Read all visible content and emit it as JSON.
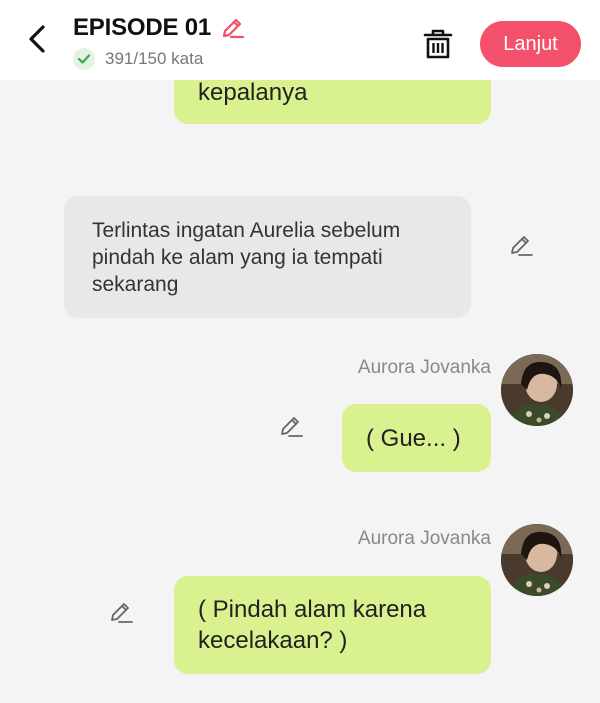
{
  "header": {
    "title": "EPISODE 01",
    "word_count": "391/150 kata",
    "next_label": "Lanjut",
    "accent_color": "#f2506b"
  },
  "messages": {
    "top_bubble_text": "kepalanya",
    "narration_text": "Terlintas ingatan Aurelia sebelum pindah ke alam yang ia tempati sekarang",
    "msg1_sender": "Aurora Jovanka",
    "msg1_text": "( Gue... )",
    "msg2_sender": "Aurora Jovanka",
    "msg2_text": "( Pindah alam karena kecelakaan? )"
  },
  "icons": [
    "back-arrow-icon",
    "pencil-icon",
    "check-icon",
    "trash-icon"
  ]
}
